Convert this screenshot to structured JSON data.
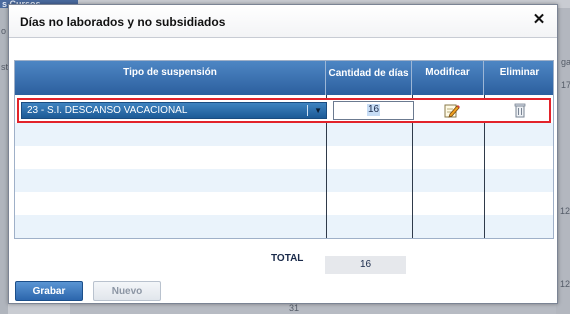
{
  "background": {
    "tab_label": "s Cursos",
    "left_fragment_1": "o",
    "left_fragment_2": "st",
    "right_fragment_1": "ga",
    "right_fragment_2": "17",
    "right_numbers": [
      "12",
      "12"
    ],
    "bottom_number": "31"
  },
  "dialog": {
    "title": "Días no laborados y no subsidiados",
    "close_label": "✕"
  },
  "grid": {
    "columns": [
      "Tipo de suspensión",
      "Cantidad de días",
      "Modificar",
      "Eliminar"
    ],
    "rows": [
      {
        "tipo": "23 - S.I. DESCANSO VACACIONAL",
        "cantidad": "16",
        "edit_icon": "edit-pencil-icon",
        "delete_icon": "trash-can-icon"
      }
    ]
  },
  "total": {
    "label": "TOTAL",
    "value": "16"
  },
  "buttons": {
    "save_label": "Grabar",
    "new_label": "Nuevo"
  },
  "colors": {
    "header_blue": "#2c5f9e",
    "selected_outline": "#e2232a",
    "row_stripe": "#eaf3fb"
  }
}
